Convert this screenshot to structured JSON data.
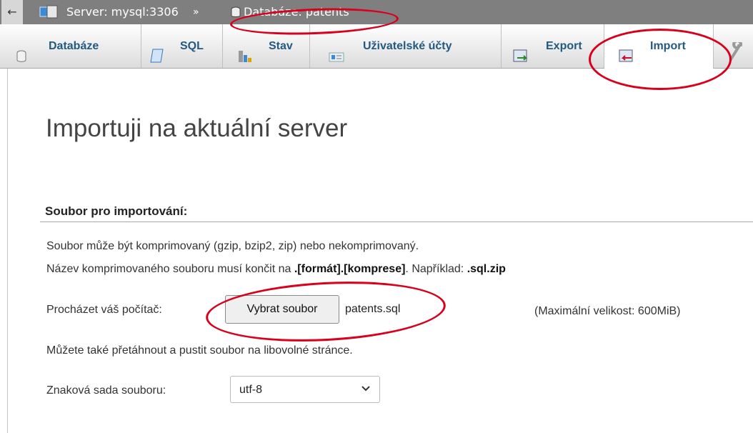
{
  "breadcrumb": {
    "back": "←",
    "server": "Server: mysql:3306",
    "separator": "»",
    "database": "Databáze: patents"
  },
  "tabs": [
    {
      "label": "Databáze",
      "icon": "database-icon"
    },
    {
      "label": "SQL",
      "icon": "sql-icon"
    },
    {
      "label": "Stav",
      "icon": "status-icon"
    },
    {
      "label": "Uživatelské účty",
      "icon": "user-accounts-icon"
    },
    {
      "label": "Export",
      "icon": "export-icon"
    },
    {
      "label": "Import",
      "icon": "import-icon",
      "active": true
    }
  ],
  "page": {
    "title": "Importuji na aktuální server",
    "file_section_title": "Soubor pro importování:",
    "hint_compressed": "Soubor může být komprimovaný (gzip, bzip2, zip) nebo nekomprimovaný.",
    "hint_name_prefix": "Název komprimovaného souboru musí končit na",
    "hint_name_format": ".[formát].[komprese]",
    "hint_name_example_prefix": ". Například:",
    "hint_name_example": ".sql.zip",
    "browse_label": "Procházet váš počítač:",
    "choose_file_button": "Vybrat soubor",
    "chosen_file": "patents.sql",
    "max_size": "(Maximální velikost: 600MiB)",
    "drop_hint": "Můžete také přetáhnout a pustit soubor na libovolné stránce.",
    "charset_label": "Znaková sada souboru:",
    "charset_value": "utf-8"
  },
  "colors": {
    "breadcrumb_bg": "#7f7f7f",
    "tab_text": "#235a81",
    "annotation": "#d8001c"
  }
}
